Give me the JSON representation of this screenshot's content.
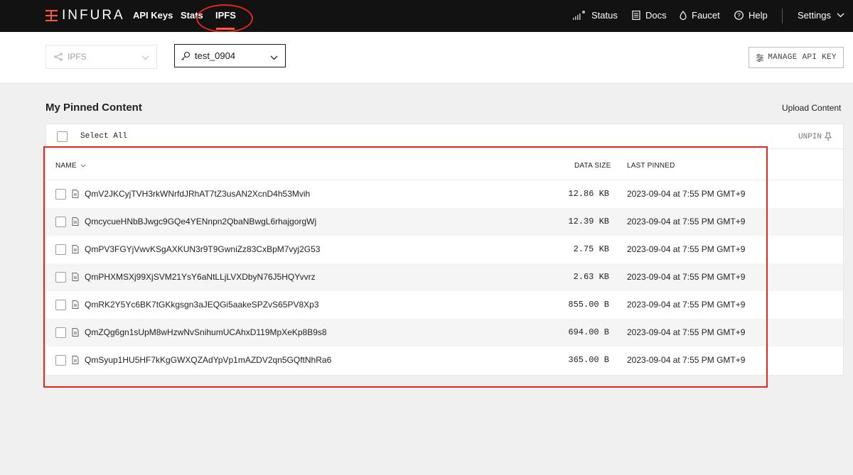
{
  "nav": {
    "logo_text": "INFURA",
    "links": [
      {
        "label": "API Keys"
      },
      {
        "label": "Stats"
      },
      {
        "label": "IPFS",
        "active": true
      }
    ],
    "right": {
      "status": "Status",
      "docs": "Docs",
      "faucet": "Faucet",
      "help": "Help",
      "settings": "Settings"
    }
  },
  "toolbar": {
    "network_select": "IPFS",
    "key_select": "test_0904",
    "manage_api_key": "MANAGE API KEY"
  },
  "content": {
    "title": "My Pinned Content",
    "upload": "Upload Content",
    "select_all": "Select All",
    "unpin": "UNPIN",
    "columns": {
      "name": "NAME",
      "size": "DATA SIZE",
      "last_pinned": "LAST PINNED"
    },
    "rows": [
      {
        "cid": "QmV2JKCyjTVH3rkWNrfdJRhAT7tZ3usAN2XcnD4h53Mvih",
        "size": "12.86 KB",
        "date": "2023-09-04 at 7:55 PM GMT+9"
      },
      {
        "cid": "QmcycueHNbBJwgc9GQe4YENnpn2QbaNBwgL6rhajgorgWj",
        "size": "12.39 KB",
        "date": "2023-09-04 at 7:55 PM GMT+9"
      },
      {
        "cid": "QmPV3FGYjVwvKSgAXKUN3r9T9GwniZz83CxBpM7vyj2G53",
        "size": "2.75 KB",
        "date": "2023-09-04 at 7:55 PM GMT+9"
      },
      {
        "cid": "QmPHXMSXj99XjSVM21YsY6aNtLLjLVXDbyN76J5HQYvvrz",
        "size": "2.63 KB",
        "date": "2023-09-04 at 7:55 PM GMT+9"
      },
      {
        "cid": "QmRK2Y5Yc6BK7tGKkgsgn3aJEQGi5aakeSPZvS65PV8Xp3",
        "size": "855.00 B",
        "date": "2023-09-04 at 7:55 PM GMT+9"
      },
      {
        "cid": "QmZQg6gn1sUpM8wHzwNvSnihumUCAhxD119MpXeKp8B9s8",
        "size": "694.00 B",
        "date": "2023-09-04 at 7:55 PM GMT+9"
      },
      {
        "cid": "QmSyup1HU5HF7kKgGWXQZAdYpVp1mAZDV2qn5GQftNhRa6",
        "size": "365.00 B",
        "date": "2023-09-04 at 7:55 PM GMT+9"
      }
    ]
  },
  "colors": {
    "brand_accent": "#ff5a36",
    "nav_bg": "#121212",
    "annotation": "#e0281c"
  }
}
